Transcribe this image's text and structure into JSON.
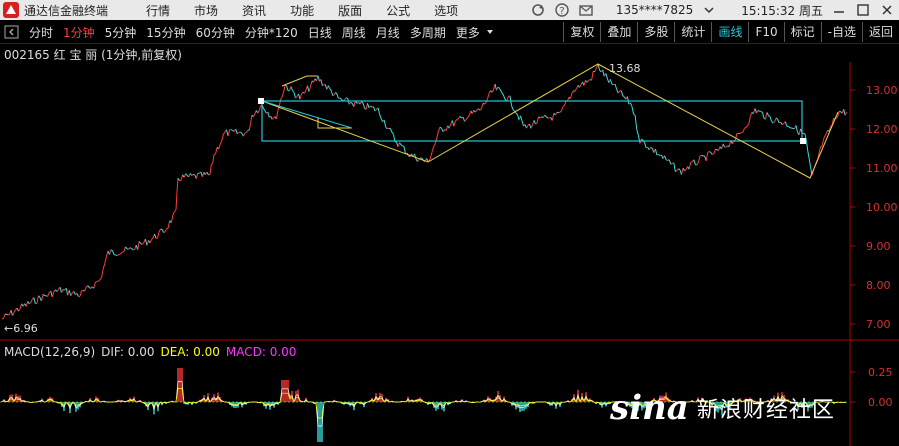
{
  "titlebar": {
    "app_title": "通达信金融终端",
    "menu": [
      "行情",
      "市场",
      "资讯",
      "功能",
      "版面",
      "公式",
      "选项"
    ],
    "account": "135****7825",
    "time": "15:15:32 周五"
  },
  "toolbar": {
    "periods": [
      "分时",
      "1分钟",
      "5分钟",
      "15分钟",
      "60分钟",
      "分钟*120",
      "日线",
      "周线",
      "月线",
      "多周期",
      "更多"
    ],
    "active_period": "1分钟",
    "right": [
      "复权",
      "叠加",
      "多股",
      "统计",
      "画线",
      "F10",
      "标记",
      "-自选",
      "返回"
    ],
    "active_right": "画线"
  },
  "stock": {
    "header": "002165 红 宝 丽 (1分钟,前复权)",
    "high_label": "13.68",
    "low_label": "6.96"
  },
  "price_axis": {
    "ticks": [
      "13.00",
      "12.00",
      "11.00",
      "10.00",
      "9.00",
      "8.00",
      "7.00"
    ]
  },
  "macd": {
    "name": "MACD(12,26,9)",
    "dif": "DIF: 0.00",
    "dea": "DEA: 0.00",
    "macd": "MACD: 0.00",
    "ticks": [
      "0.25",
      "0.00"
    ]
  },
  "watermark": {
    "logo": "sina",
    "text": "新浪财经社区"
  },
  "colors": {
    "up": "#ff3b3b",
    "down": "#34e0e0",
    "dif": "#ffffff",
    "dea": "#ffff00",
    "macd": "#ff33ff",
    "axis": "#b00000"
  }
}
